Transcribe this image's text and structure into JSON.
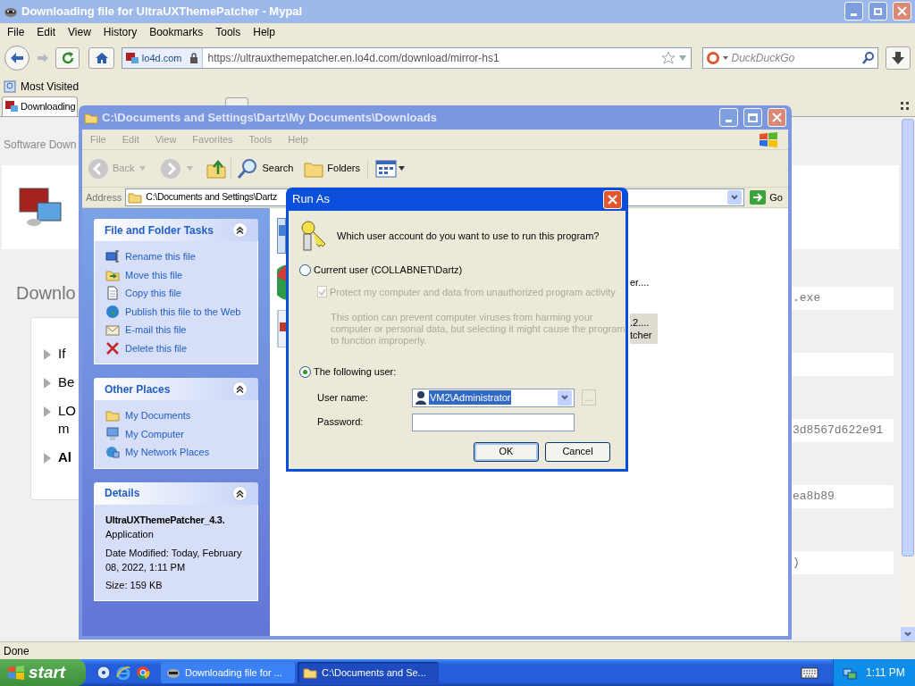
{
  "browser": {
    "title": "Downloading file for UltraUXThemePatcher - Mypal",
    "active": false,
    "menu": [
      "File",
      "Edit",
      "View",
      "History",
      "Bookmarks",
      "Tools",
      "Help"
    ],
    "site_badge": "lo4d.com",
    "url": "https://ultrauxthemepatcher.en.lo4d.com/download/mirror-hs1",
    "search": {
      "placeholder": "DuckDuckGo"
    },
    "bookmarks": [
      "Most Visited"
    ],
    "tabs": [
      {
        "label": "Downloading",
        "selected": true
      }
    ],
    "page": {
      "breadcrumb": "Software Down",
      "heading": "Downlo",
      "bullets": [
        {
          "lines": [
            "If"
          ],
          "bold": false
        },
        {
          "lines": [
            "Be"
          ],
          "bold": false
        },
        {
          "lines": [
            "LO",
            "m"
          ],
          "bold": false
        },
        {
          "lines": [
            "Al"
          ],
          "bold": true
        }
      ],
      "code_boxes": [
        {
          "kind": "text",
          "text": ".exe"
        },
        {
          "kind": "empty"
        },
        {
          "kind": "text",
          "text": "3d8567d622e91"
        },
        {
          "kind": "text",
          "text": "ea8b89"
        },
        {
          "kind": "text",
          "text": ")"
        }
      ]
    },
    "status": "Done"
  },
  "explorer": {
    "title": "C:\\Documents and Settings\\Dartz\\My Documents\\Downloads",
    "active": false,
    "menu": [
      "File",
      "Edit",
      "View",
      "Favorites",
      "Tools",
      "Help"
    ],
    "toolbar": [
      {
        "kind": "back",
        "label": "Back"
      },
      {
        "kind": "forward"
      },
      {
        "kind": "up"
      },
      {
        "kind": "search",
        "label": "Search"
      },
      {
        "kind": "folders",
        "label": "Folders"
      },
      {
        "kind": "views"
      }
    ],
    "address": {
      "label": "Address",
      "value": "C:\\Documents and Settings\\Dartz",
      "go": "Go"
    },
    "panels": [
      {
        "title": "File and Folder Tasks",
        "expanded": true,
        "links": [
          {
            "kind": "rename",
            "label": "Rename this file"
          },
          {
            "kind": "move",
            "label": "Move this file"
          },
          {
            "kind": "copy",
            "label": "Copy this file"
          },
          {
            "kind": "globe",
            "label": "Publish this file to the Web"
          },
          {
            "kind": "mail",
            "label": "E-mail this file"
          },
          {
            "kind": "delete",
            "label": "Delete this file"
          }
        ]
      },
      {
        "title": "Other Places",
        "expanded": true,
        "links": [
          {
            "kind": "folder",
            "label": "My Documents"
          },
          {
            "kind": "computer",
            "label": "My Computer"
          },
          {
            "kind": "network",
            "label": "My Network Places"
          }
        ]
      },
      {
        "title": "Details",
        "expanded": true,
        "details": {
          "name": "UltraUXThemePatcher_4.3.",
          "type": "Application",
          "modified": "Date Modified: Today, February 08, 2022, 1:11 PM",
          "size": "Size: 159 KB"
        }
      }
    ],
    "files": [
      {
        "kind": "installer",
        "selected": false
      },
      {
        "kind": "pie",
        "lines": [
          "er...."
        ],
        "selected": false
      },
      {
        "kind": "exe",
        "lines": [
          ".2....",
          "tcher"
        ],
        "selected": true
      }
    ]
  },
  "dialog": {
    "title": "Run As",
    "active": true,
    "question": "Which user account do you want to use to run this program?",
    "options": [
      {
        "label": "Current user (COLLABNET\\Dartz)",
        "selected": false
      },
      {
        "label": "The following user:",
        "selected": true
      }
    ],
    "protect": {
      "label": "Protect my computer and data from unauthorized program activity",
      "checked": true,
      "disabled": true
    },
    "note": "This option can prevent computer viruses from harming your computer or personal data, but selecting it might cause the program to function improperly.",
    "username": {
      "label": "User name:",
      "value": "VM2\\Administrator",
      "highlighted": true
    },
    "password": {
      "label": "Password:"
    },
    "browse": "...",
    "buttons": [
      {
        "label": "OK",
        "default": true
      },
      {
        "label": "Cancel",
        "default": false
      }
    ]
  },
  "taskbar": {
    "start": "start",
    "tasks": [
      {
        "kind": "browser",
        "label": "Downloading file for ...",
        "selected": false
      },
      {
        "kind": "folder",
        "label": "C:\\Documents and Se...",
        "selected": true
      }
    ],
    "clock": "1:11 PM"
  }
}
